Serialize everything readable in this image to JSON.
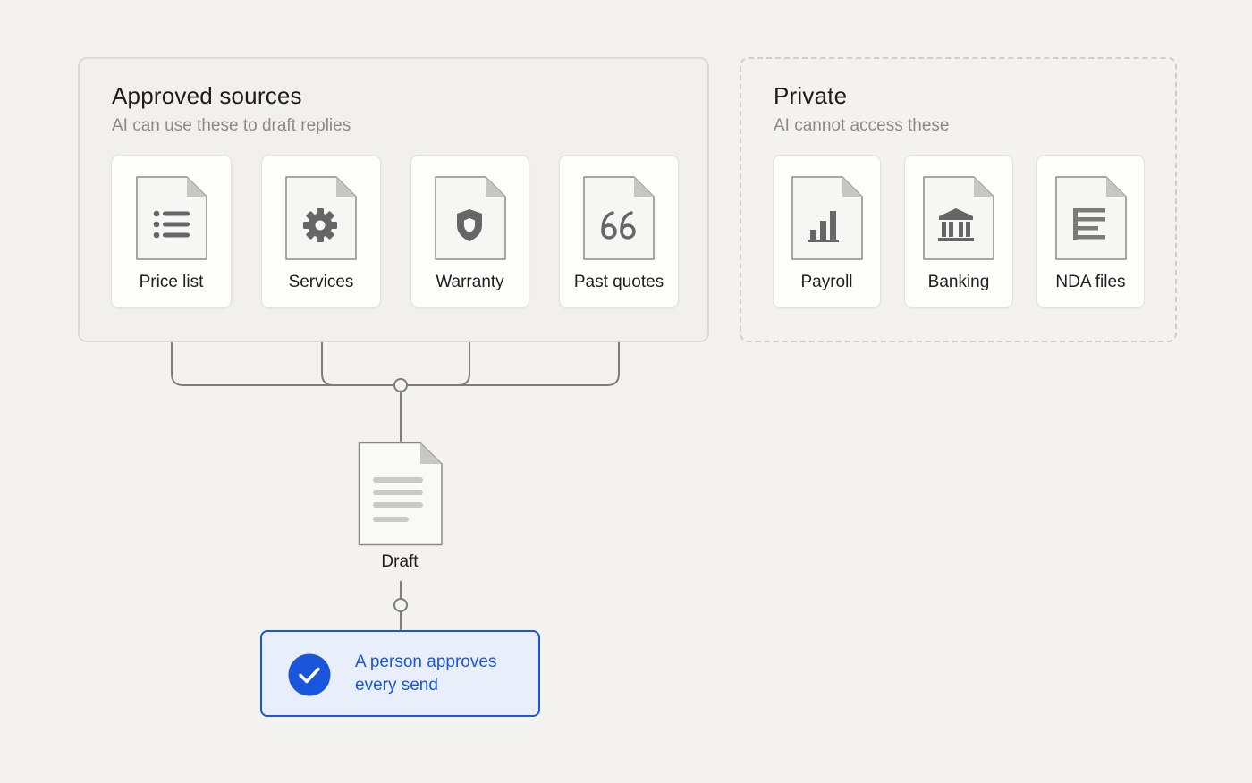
{
  "approved": {
    "title": "Approved sources",
    "subtitle": "AI can use these to draft replies",
    "items": [
      {
        "label": "Price list",
        "icon": "list-icon"
      },
      {
        "label": "Services",
        "icon": "gear-icon"
      },
      {
        "label": "Warranty",
        "icon": "shield-icon"
      },
      {
        "label": "Past quotes",
        "icon": "quote-icon"
      }
    ]
  },
  "private": {
    "title": "Private",
    "subtitle": "AI cannot access these",
    "items": [
      {
        "label": "Payroll",
        "icon": "bar-chart-icon"
      },
      {
        "label": "Banking",
        "icon": "bank-icon"
      },
      {
        "label": "NDA files",
        "icon": "text-lines-icon"
      }
    ]
  },
  "draft": {
    "label": "Draft",
    "icon": "document-lines-icon"
  },
  "approval": {
    "text": "A person approves every send",
    "icon": "checkmark-icon"
  },
  "colors": {
    "background": "#f3f2ef",
    "accent": "#1a56db",
    "accent_fill": "#e8effb",
    "icon_gray": "#6f6f6f",
    "connector": "#7a7a7a"
  }
}
